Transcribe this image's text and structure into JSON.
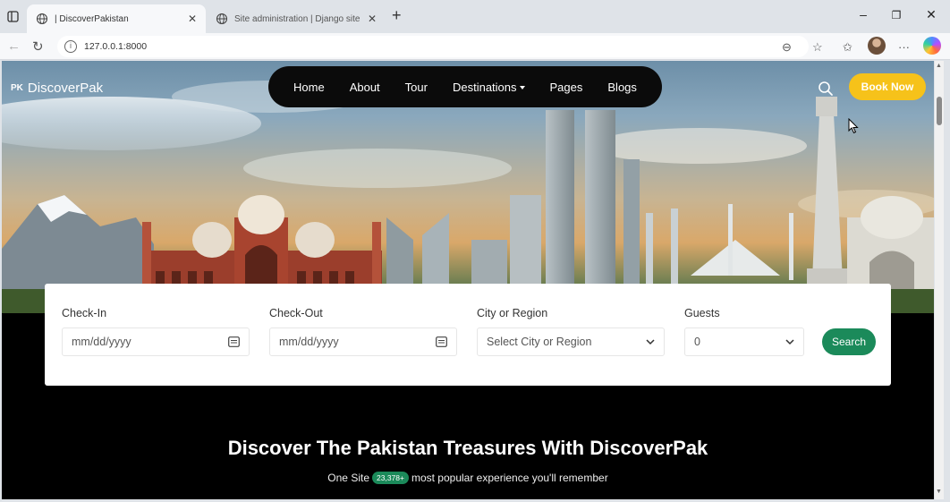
{
  "browser": {
    "tabs": [
      {
        "title": "| DiscoverPakistan",
        "active": true
      },
      {
        "title": "Site administration | Django site a",
        "active": false
      }
    ],
    "url": "127.0.0.1:8000",
    "window_controls": {
      "minimize": "–",
      "restore": "❐",
      "close": "✕"
    }
  },
  "site": {
    "brand_mark": "PK",
    "brand_name": "DiscoverPak",
    "nav": [
      "Home",
      "About",
      "Tour",
      "Destinations",
      "Pages",
      "Blogs"
    ],
    "book_now": "Book Now",
    "accent": "#f6c21a",
    "green": "#1b8a5a"
  },
  "booking": {
    "checkin_label": "Check-In",
    "checkin_placeholder": "mm/dd/yyyy",
    "checkout_label": "Check-Out",
    "checkout_placeholder": "mm/dd/yyyy",
    "city_label": "City or Region",
    "city_value": "Select City or Region",
    "guests_label": "Guests",
    "guests_value": "0",
    "search_label": "Search"
  },
  "hero_text": {
    "heading": "Discover The Pakistan Treasures With DiscoverPak",
    "sub_before": "One Site",
    "sub_badge": "23,378+",
    "sub_after": "most popular experience you'll remember"
  }
}
